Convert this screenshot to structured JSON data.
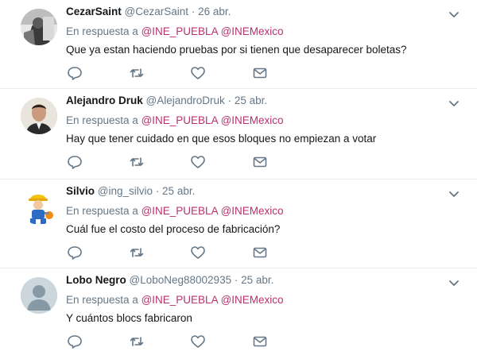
{
  "tweets": [
    {
      "name": "CezarSaint",
      "handle": "@CezarSaint",
      "dot": "·",
      "time": "26 abr.",
      "reply_prefix": "En respuesta a",
      "mention1": "@INE_PUEBLA",
      "mention2": "@INEMexico",
      "text": "Que ya estan haciendo pruebas por si tienen que desaparecer boletas?",
      "avatar": "photo-avatar"
    },
    {
      "name": "Alejandro Druk",
      "handle": "@AlejandroDruk",
      "dot": "·",
      "time": "25 abr.",
      "reply_prefix": "En respuesta a",
      "mention1": "@INE_PUEBLA",
      "mention2": "@INEMexico",
      "text": "Hay que tener cuidado en que esos bloques no empiezan a votar",
      "avatar": "photo-avatar"
    },
    {
      "name": "Silvio",
      "handle": "@ing_silvio",
      "dot": "·",
      "time": "25 abr.",
      "reply_prefix": "En respuesta a",
      "mention1": "@INE_PUEBLA",
      "mention2": "@INEMexico",
      "text": "Cuál fue el costo del proceso de fabricación?",
      "avatar": "cartoon-worker-avatar"
    },
    {
      "name": "Lobo Negro",
      "handle": "@LoboNeg88002935",
      "dot": "·",
      "time": "25 abr.",
      "reply_prefix": "En respuesta a",
      "mention1": "@INE_PUEBLA",
      "mention2": "@INEMexico",
      "text": "Y cuántos blocs fabricaron",
      "avatar": "default-avatar"
    }
  ],
  "icons": {
    "reply": "reply-icon",
    "retweet": "retweet-icon",
    "like": "heart-icon",
    "dm": "envelope-icon",
    "menu": "chevron-down-icon"
  },
  "colors": {
    "mention": "#b9316d",
    "muted": "#657786",
    "text": "#14171a",
    "divider": "#e6ecf0"
  }
}
